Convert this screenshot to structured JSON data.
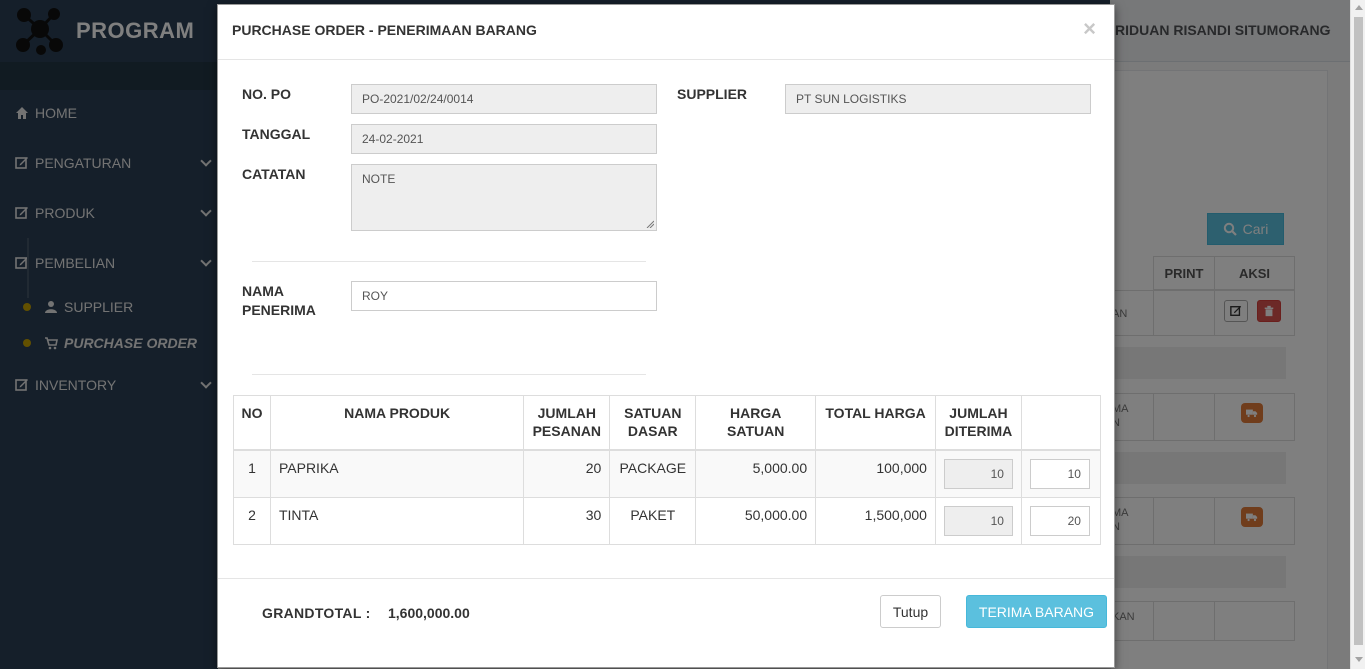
{
  "app": {
    "brand": "PROGRAM",
    "user_name": "RIDUAN RISANDI SITUMORANG"
  },
  "sidebar": {
    "items": [
      {
        "label": "HOME",
        "icon": "home-icon"
      },
      {
        "label": "PENGATURAN",
        "icon": "edit-icon"
      },
      {
        "label": "PRODUK",
        "icon": "edit-icon"
      },
      {
        "label": "PEMBELIAN",
        "icon": "edit-icon"
      },
      {
        "label": "INVENTORY",
        "icon": "edit-icon"
      }
    ],
    "sub_items": [
      {
        "label": "SUPPLIER",
        "icon": "user-icon"
      },
      {
        "label": "PURCHASE ORDER",
        "icon": "cart-icon",
        "active": true
      }
    ]
  },
  "background": {
    "search_button": "Cari",
    "table_headers": [
      "PRINT",
      "AKSI"
    ],
    "partial_texts": [
      "AN",
      "MA\nN",
      "MA\nN",
      "KAN"
    ]
  },
  "modal": {
    "title": "PURCHASE ORDER - PENERIMAAN BARANG",
    "close_symbol": "×",
    "form": {
      "no_po_label": "NO. PO",
      "no_po_value": "PO-2021/02/24/0014",
      "supplier_label": "SUPPLIER",
      "supplier_value": "PT SUN LOGISTIKS",
      "tanggal_label": "TANGGAL",
      "tanggal_value": "24-02-2021",
      "catatan_label": "CATATAN",
      "catatan_value": "NOTE",
      "penerima_label_1": "NAMA",
      "penerima_label_2": "PENERIMA",
      "penerima_value": "ROY"
    },
    "table": {
      "headers": [
        [
          "NO"
        ],
        [
          "NAMA PRODUK"
        ],
        [
          "JUMLAH",
          "PESANAN"
        ],
        [
          "SATUAN",
          "DASAR"
        ],
        [
          "HARGA",
          "SATUAN"
        ],
        [
          "TOTAL HARGA"
        ],
        [
          "JUMLAH",
          "DITERIMA"
        ],
        [
          ""
        ]
      ],
      "rows": [
        {
          "no": "1",
          "nama_produk": "PAPRIKA",
          "jumlah_pesanan": "20",
          "satuan_dasar": "PACKAGE",
          "harga_satuan": "5,000.00",
          "total_harga": "100,000",
          "jumlah_diterima": "10",
          "terima_input": "10"
        },
        {
          "no": "2",
          "nama_produk": "TINTA",
          "jumlah_pesanan": "30",
          "satuan_dasar": "PAKET",
          "harga_satuan": "50,000.00",
          "total_harga": "1,500,000",
          "jumlah_diterima": "10",
          "terima_input": "20"
        }
      ]
    },
    "footer": {
      "grandtotal_label": "GRANDTOTAL :",
      "grandtotal_value": "1,600,000.00",
      "tutup_label": "Tutup",
      "terima_label": "TERIMA BARANG"
    }
  },
  "colors": {
    "sidebar_bg": "#2a3f54",
    "accent_info": "#5bc0de",
    "danger": "#d9534f",
    "warning": "#e07b39",
    "active_dot": "#c4a000"
  }
}
